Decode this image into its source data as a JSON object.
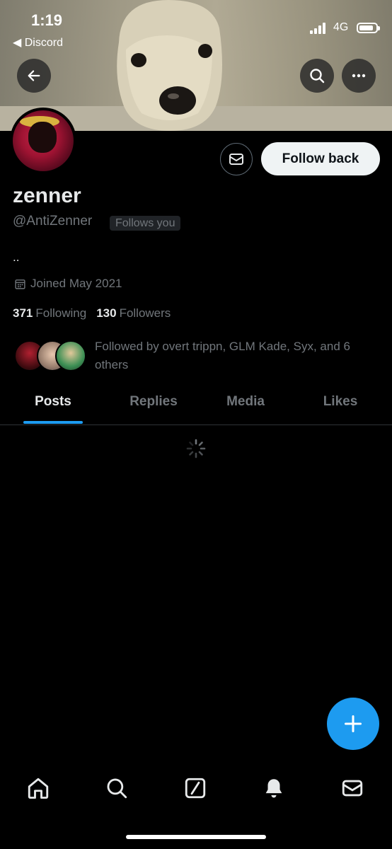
{
  "status_bar": {
    "time": "1:19",
    "back_app": "◀ Discord",
    "network": "4G"
  },
  "profile": {
    "name": "zenner",
    "handle": "@AntiZenner",
    "follows_you_badge": "Follows you",
    "bio": "..",
    "joined": "Joined May 2021",
    "following_count": "371",
    "following_label": "Following",
    "followers_count": "130",
    "followers_label": "Followers",
    "followed_by_text": "Followed by overt trippn, GLM Kade, Syx, and 6 others"
  },
  "actions": {
    "follow_back_label": "Follow back"
  },
  "tabs": [
    {
      "label": "Posts",
      "active": true
    },
    {
      "label": "Replies",
      "active": false
    },
    {
      "label": "Media",
      "active": false
    },
    {
      "label": "Likes",
      "active": false
    }
  ],
  "bottom_nav": [
    {
      "icon": "home-icon"
    },
    {
      "icon": "search-icon"
    },
    {
      "icon": "grok-icon"
    },
    {
      "icon": "notifications-icon"
    },
    {
      "icon": "messages-icon"
    }
  ],
  "colors": {
    "accent": "#1d9bf0",
    "background": "#000000",
    "muted_text": "#71767b"
  }
}
